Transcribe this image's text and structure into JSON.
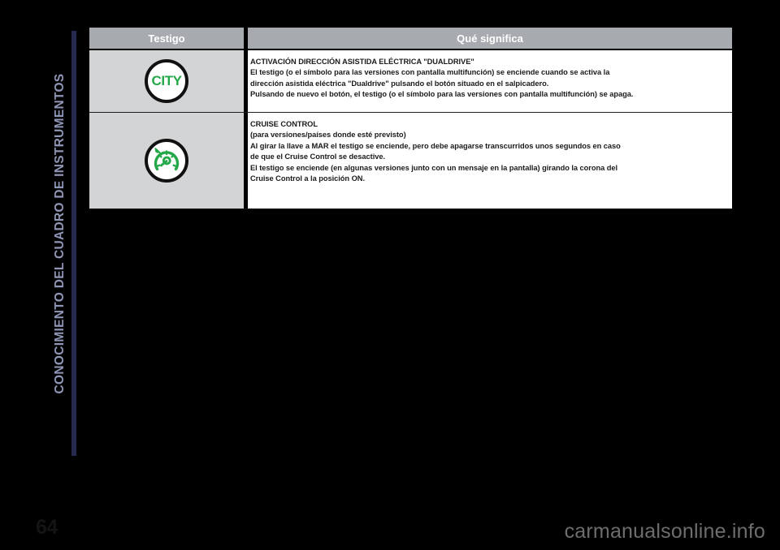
{
  "sidebar": {
    "chapter_title": "CONOCIMIENTO DEL CUADRO DE INSTRUMENTOS",
    "rule_color": "#262a4e",
    "text_color": "#8f95b5"
  },
  "page": {
    "number": "64",
    "watermark": "carmanualsonline.info",
    "background_color": "#000000"
  },
  "table": {
    "headers": {
      "symbol": "Testigo",
      "meaning": "Qué significa"
    },
    "header_bg": "#a7aaae",
    "header_text_color": "#ffffff",
    "symbol_cell_bg": "#d3d4d6",
    "desc_cell_bg": "#ffffff",
    "rows": [
      {
        "icon_name": "city-telltale-icon",
        "icon_label": "CITY",
        "icon_color": "#25a84a",
        "title": "ACTIVACIÓN DIRECCIÓN ASISTIDA ELÉCTRICA \"DUALDRIVE\"",
        "lines": [
          "El testigo (o el símbolo para las versiones con pantalla multifunción) se enciende cuando se activa la",
          "dirección asistida eléctrica \"Dualdrive\" pulsando el botón situado en el salpicadero.",
          "Pulsando de nuevo el botón, el testigo (o el símbolo para las versiones con pantalla multifunción) se apaga."
        ]
      },
      {
        "icon_name": "cruise-control-telltale-icon",
        "icon_label": "",
        "icon_color": "#25a84a",
        "title": "CRUISE CONTROL",
        "lines": [
          "(para versiones/países donde esté previsto)",
          "Al girar la llave a MAR el testigo se enciende, pero debe apagarse transcurridos unos segundos en caso",
          "de que el Cruise Control se desactive.",
          "El testigo se enciende (en algunas versiones junto con un mensaje en la pantalla) girando la corona del",
          "Cruise Control a la posición ON."
        ]
      }
    ]
  }
}
